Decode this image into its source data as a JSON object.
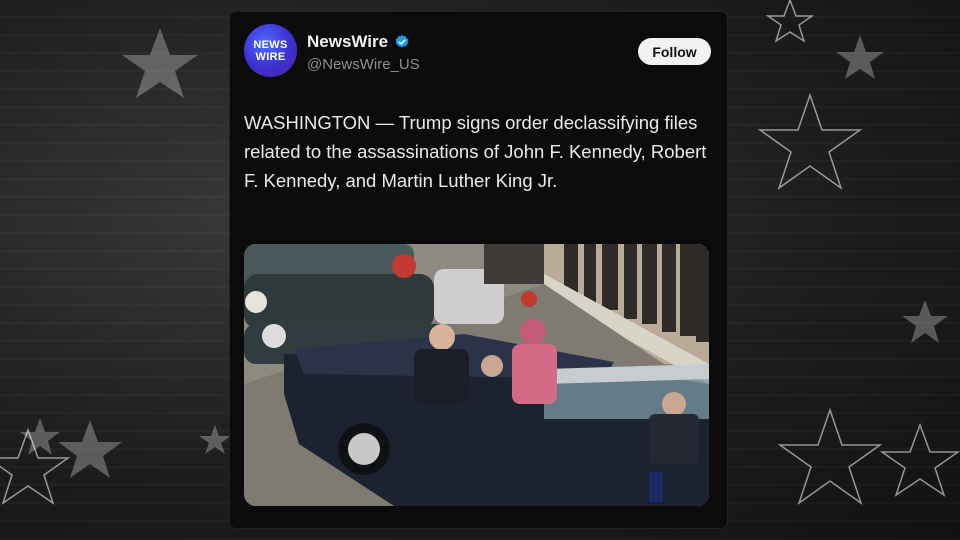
{
  "post": {
    "avatar_text_line1": "NEWS",
    "avatar_text_line2": "WIRE",
    "display_name": "NewsWire",
    "handle": "@NewsWire_US",
    "follow_label": "Follow",
    "text": "WASHINGTON — Trump signs order declassifying files related to the assassinations of John F. Kennedy, Robert F. Kennedy, and Martin Luther King Jr."
  },
  "icons": {
    "verified": "verified-badge-icon",
    "background": "star-icon"
  },
  "colors": {
    "verified_blue": "#1d9bf0",
    "card_bg": "#0b0b0c",
    "follow_bg": "#f2f2f2"
  }
}
